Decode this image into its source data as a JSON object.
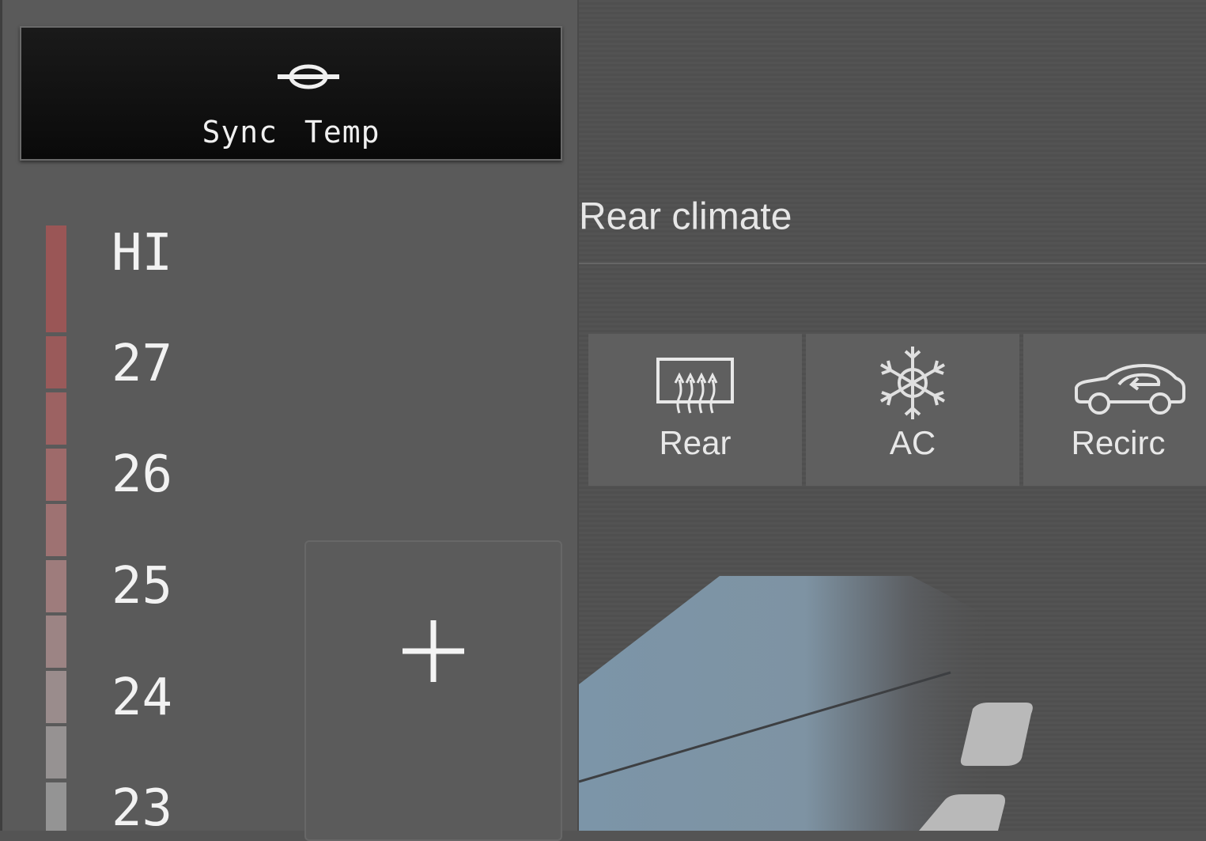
{
  "sync": {
    "label": "Sync Temp",
    "icon": "sync-link-icon"
  },
  "temperature": {
    "scale": [
      "HI",
      "27",
      "26",
      "25",
      "24",
      "23"
    ],
    "bar_colors": [
      "#9a5656",
      "#9a5a5a",
      "#9c6262",
      "#9e6a6a",
      "#9e7272",
      "#9e7c7c",
      "#9c8484",
      "#9a8c8c",
      "#969292",
      "#949494"
    ]
  },
  "plus_button": {
    "icon": "plus-icon"
  },
  "rear_climate": {
    "title": "Rear climate",
    "buttons": [
      {
        "label": "Rear",
        "icon": "rear-defrost-icon"
      },
      {
        "label": "AC",
        "icon": "snowflake-icon"
      },
      {
        "label": "Recirc",
        "icon": "recirc-car-icon"
      }
    ]
  },
  "colors": {
    "accent_hot": "#9a5656",
    "panel_bg": "#5a5a5a",
    "button_dark": "#0d0d0d"
  }
}
